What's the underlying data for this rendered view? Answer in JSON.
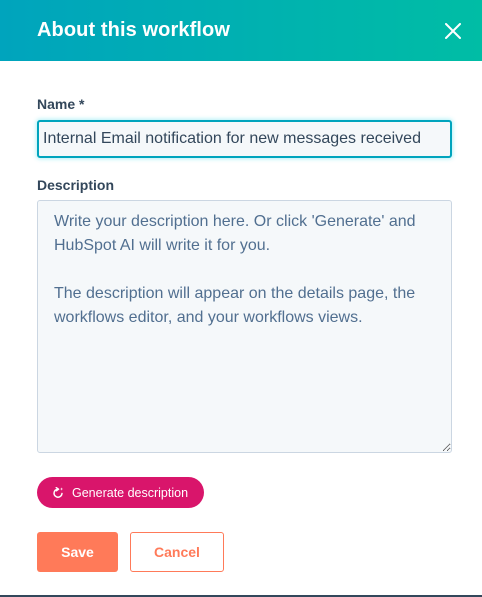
{
  "dialog": {
    "title": "About this workflow"
  },
  "name_field": {
    "label": "Name *",
    "value": "Internal Email notification for new messages received"
  },
  "description_field": {
    "label": "Description",
    "placeholder": "Write your description here. Or click 'Generate' and HubSpot AI will write it for you.\n\nThe description will appear on the details page, the workflows editor, and your workflows views."
  },
  "actions": {
    "generate_label": "Generate description",
    "save_label": "Save",
    "cancel_label": "Cancel"
  },
  "colors": {
    "header_gradient_start": "#00a4bd",
    "header_gradient_end": "#00bda5",
    "generate_button": "#d9156b",
    "primary_button": "#ff7a59",
    "text": "#33475b"
  },
  "icons": {
    "close": "close-icon",
    "generate": "regenerate-sparkle-icon"
  }
}
